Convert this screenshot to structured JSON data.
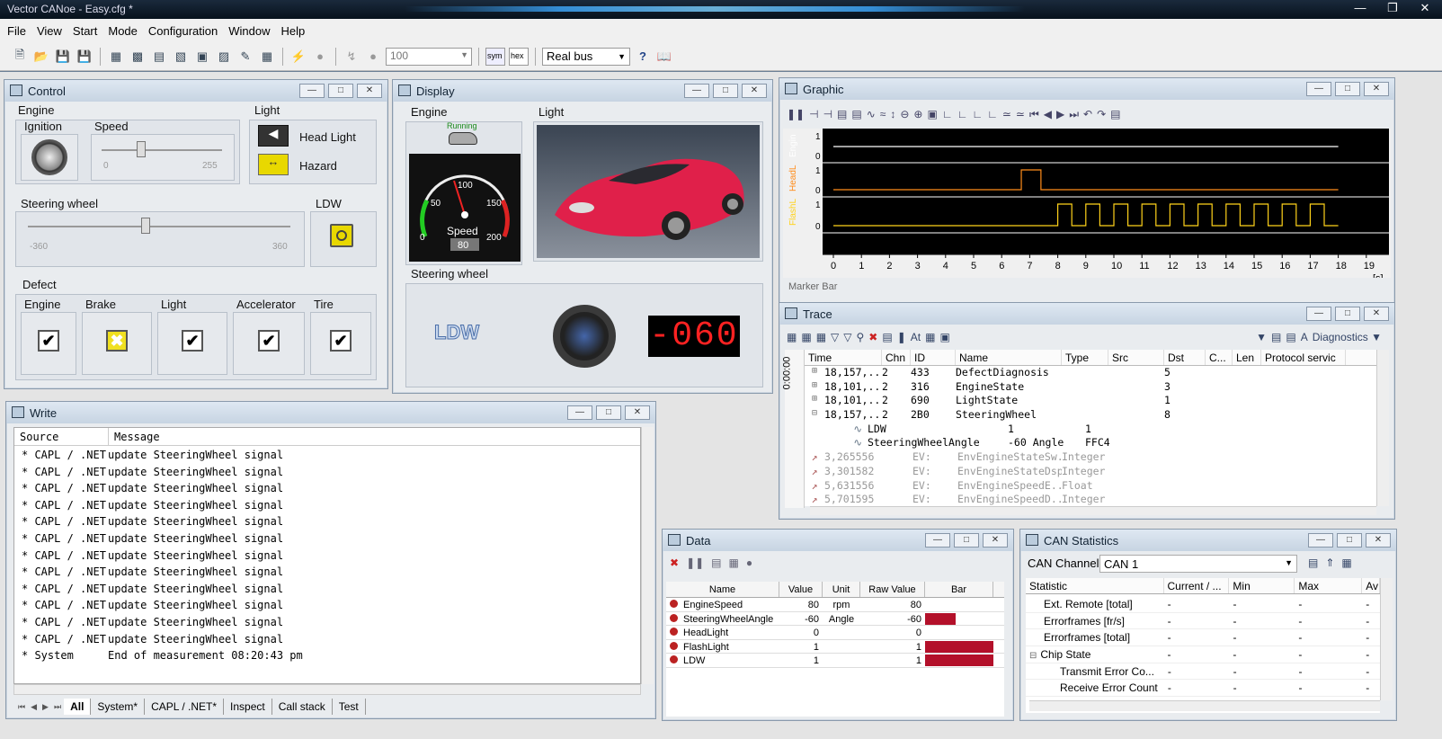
{
  "app": {
    "title": "Vector CANoe - Easy.cfg *"
  },
  "menu": [
    "File",
    "View",
    "Start",
    "Mode",
    "Configuration",
    "Window",
    "Help"
  ],
  "toolbar": {
    "count_value": "100",
    "sym": "sym",
    "hex": "hex",
    "bus_mode": "Real bus"
  },
  "control": {
    "title": "Control",
    "engine": "Engine",
    "ignition": "Ignition",
    "speed": "Speed",
    "speed_min": "0",
    "speed_max": "255",
    "light": "Light",
    "head_light": "Head Light",
    "hazard": "Hazard",
    "steering": "Steering wheel",
    "steer_min": "-360",
    "steer_max": "360",
    "ldw": "LDW",
    "defect": "Defect",
    "defects": [
      "Engine",
      "Brake",
      "Light",
      "Accelerator",
      "Tire"
    ],
    "speed_level": 0.33,
    "steer_level": 0.45
  },
  "display": {
    "title": "Display",
    "engine": "Engine",
    "running": "Running",
    "light": "Light",
    "gauge_label": "Speed",
    "gauge_value": "80",
    "gauge_ticks": [
      "0",
      "50",
      "100",
      "150",
      "200"
    ],
    "steering": "Steering wheel",
    "ldw_label": "LDW",
    "angle_display": "-060"
  },
  "graphic": {
    "title": "Graphic",
    "signals": [
      {
        "name": "Engin",
        "color": "#ffffff"
      },
      {
        "name": "HeadL",
        "color": "#ff8c1a"
      },
      {
        "name": "FlashL",
        "color": "#ffd21a"
      }
    ],
    "y_ticks": [
      "1",
      "0"
    ],
    "x_ticks": [
      "0",
      "1",
      "2",
      "3",
      "4",
      "5",
      "6",
      "7",
      "8",
      "9",
      "10",
      "11",
      "12",
      "13",
      "14",
      "15",
      "16",
      "17",
      "18",
      "19"
    ],
    "x_unit": "[s]",
    "marker_bar": "Marker Bar"
  },
  "trace": {
    "title": "Trace",
    "diagnostics": "Diagnostics",
    "time_prefix": "0:00:00",
    "columns": [
      "Time",
      "Chn",
      "ID",
      "Name",
      "Type",
      "Src",
      "Dst",
      "C...",
      "Len",
      "Protocol servic"
    ],
    "rows": [
      {
        "time": "18,157,..",
        "chn": "2",
        "id": "433",
        "name": "DefectDiagnosis",
        "type": "",
        "len": "5"
      },
      {
        "time": "18,101,..",
        "chn": "2",
        "id": "316",
        "name": "EngineState",
        "type": "",
        "len": "3"
      },
      {
        "time": "18,101,..",
        "chn": "2",
        "id": "690",
        "name": "LightState",
        "type": "",
        "len": "1"
      },
      {
        "time": "18,157,..",
        "chn": "2",
        "id": "2B0",
        "name": "SteeringWheel",
        "type": "",
        "len": "8"
      }
    ],
    "signals": [
      {
        "name": "LDW",
        "value": "1",
        "raw": "1"
      },
      {
        "name": "SteeringWheelAngle",
        "value": "-60 Angle",
        "raw": "FFC4"
      }
    ],
    "env_rows": [
      {
        "time": "3,265556",
        "ev": "EV:",
        "name": "EnvEngineStateSw...",
        "type": "Integer"
      },
      {
        "time": "3,301582",
        "ev": "EV:",
        "name": "EnvEngineStateDsp",
        "type": "Integer"
      },
      {
        "time": "5,631556",
        "ev": "EV:",
        "name": "EnvEngineSpeedE...",
        "type": "Float"
      },
      {
        "time": "5,701595",
        "ev": "EV:",
        "name": "EnvEngineSpeedD...",
        "type": "Integer"
      }
    ]
  },
  "write": {
    "title": "Write",
    "col_source": "Source",
    "col_message": "Message",
    "rows": [
      {
        "src": "* CAPL / .NET",
        "msg": "update SteeringWheel signal"
      },
      {
        "src": "* CAPL / .NET",
        "msg": "update SteeringWheel signal"
      },
      {
        "src": "* CAPL / .NET",
        "msg": "update SteeringWheel signal"
      },
      {
        "src": "* CAPL / .NET",
        "msg": "update SteeringWheel signal"
      },
      {
        "src": "* CAPL / .NET",
        "msg": "update SteeringWheel signal"
      },
      {
        "src": "* CAPL / .NET",
        "msg": "update SteeringWheel signal"
      },
      {
        "src": "* CAPL / .NET",
        "msg": "update SteeringWheel signal"
      },
      {
        "src": "* CAPL / .NET",
        "msg": "update SteeringWheel signal"
      },
      {
        "src": "* CAPL / .NET",
        "msg": "update SteeringWheel signal"
      },
      {
        "src": "* CAPL / .NET",
        "msg": "update SteeringWheel signal"
      },
      {
        "src": "* CAPL / .NET",
        "msg": "update SteeringWheel signal"
      },
      {
        "src": "* CAPL / .NET",
        "msg": "update SteeringWheel signal"
      },
      {
        "src": "* System",
        "msg": "End of measurement 08:20:43 pm"
      }
    ],
    "tabs": [
      "All",
      "System*",
      "CAPL / .NET*",
      "Inspect",
      "Call stack",
      "Test"
    ]
  },
  "data": {
    "title": "Data",
    "columns": [
      "Name",
      "Value",
      "Unit",
      "Raw Value",
      "Bar"
    ],
    "rows": [
      {
        "name": "EngineSpeed",
        "value": "80",
        "unit": "rpm",
        "raw": "80",
        "bar": 0
      },
      {
        "name": "SteeringWheelAngle",
        "value": "-60",
        "unit": "Angle",
        "raw": "-60",
        "bar": 0.45
      },
      {
        "name": "HeadLight",
        "value": "0",
        "unit": "",
        "raw": "0",
        "bar": 0
      },
      {
        "name": "FlashLight",
        "value": "1",
        "unit": "",
        "raw": "1",
        "bar": 1
      },
      {
        "name": "LDW",
        "value": "1",
        "unit": "",
        "raw": "1",
        "bar": 1
      }
    ],
    "bar_color": "#b3102a"
  },
  "canstats": {
    "title": "CAN Statistics",
    "channel_label": "CAN Channel:",
    "channel": "CAN 1",
    "columns": [
      "Statistic",
      "Current / ...",
      "Min",
      "Max",
      "Av"
    ],
    "rows": [
      {
        "name": "Ext. Remote [total]",
        "cur": "-",
        "min": "-",
        "max": "-",
        "av": "-"
      },
      {
        "name": "Errorframes [fr/s]",
        "cur": "-",
        "min": "-",
        "max": "-",
        "av": "-"
      },
      {
        "name": "Errorframes [total]",
        "cur": "-",
        "min": "-",
        "max": "-",
        "av": "-"
      },
      {
        "name": "Chip State",
        "cur": "-",
        "min": "-",
        "max": "-",
        "av": "-"
      },
      {
        "name": "Transmit Error Co...",
        "cur": "-",
        "min": "-",
        "max": "-",
        "av": "-"
      },
      {
        "name": "Receive Error Count",
        "cur": "-",
        "min": "-",
        "max": "-",
        "av": "-"
      }
    ]
  }
}
